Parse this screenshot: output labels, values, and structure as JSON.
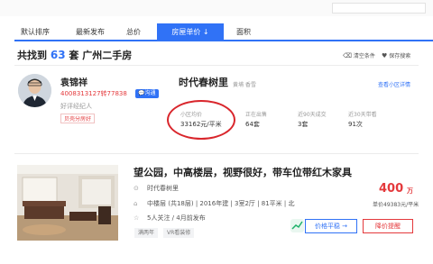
{
  "tabs": [
    {
      "label": "默认排序"
    },
    {
      "label": "最新发布"
    },
    {
      "label": "总价"
    },
    {
      "label": "房屋单价 ↓"
    },
    {
      "label": "面积"
    }
  ],
  "summary": {
    "prefix": "共找到",
    "count": "63",
    "suffix": "套 广州二手房"
  },
  "actions": {
    "clear": "清空条件",
    "save": "保存搜索"
  },
  "agent": {
    "name": "袁锦祥",
    "phone": "4008313127转77838",
    "chat": "沟通",
    "rating": "好评经纪人",
    "shop": "贝壳分房好"
  },
  "community": {
    "name": "时代春树里",
    "area": "黄埔 香雪",
    "link": "查看小区详情",
    "stats": [
      {
        "label": "小区均价",
        "value": "33162元/平米"
      },
      {
        "label": "正在出售",
        "value": "64套"
      },
      {
        "label": "近90天成交",
        "value": "3套"
      },
      {
        "label": "近30天带看",
        "value": "91次"
      }
    ]
  },
  "listing": {
    "title": "望公园，中高楼层，视野很好，带车位带红木家具",
    "community": "时代春树里",
    "details": "中楼层 (共18层) | 2016年建 | 3室2厅 | 81平米 | 北",
    "followers": "5人关注 / 4月前发布",
    "tags": [
      "满两年",
      "VR看装修"
    ],
    "price_value": "400",
    "price_unit": "万",
    "unit_price": "单价49383元/平米",
    "btn_price": "价格平稳 →",
    "btn_reduce": "降价提醒"
  },
  "icons": [
    "ticket-icon",
    "heart-icon",
    "location-icon",
    "home-icon",
    "star-icon",
    "chart-icon",
    "chat-icon",
    "eraser-icon"
  ],
  "colors": {
    "accent": "#3072f6",
    "price_red": "#e4393c",
    "annotation_red": "#d9262c"
  }
}
